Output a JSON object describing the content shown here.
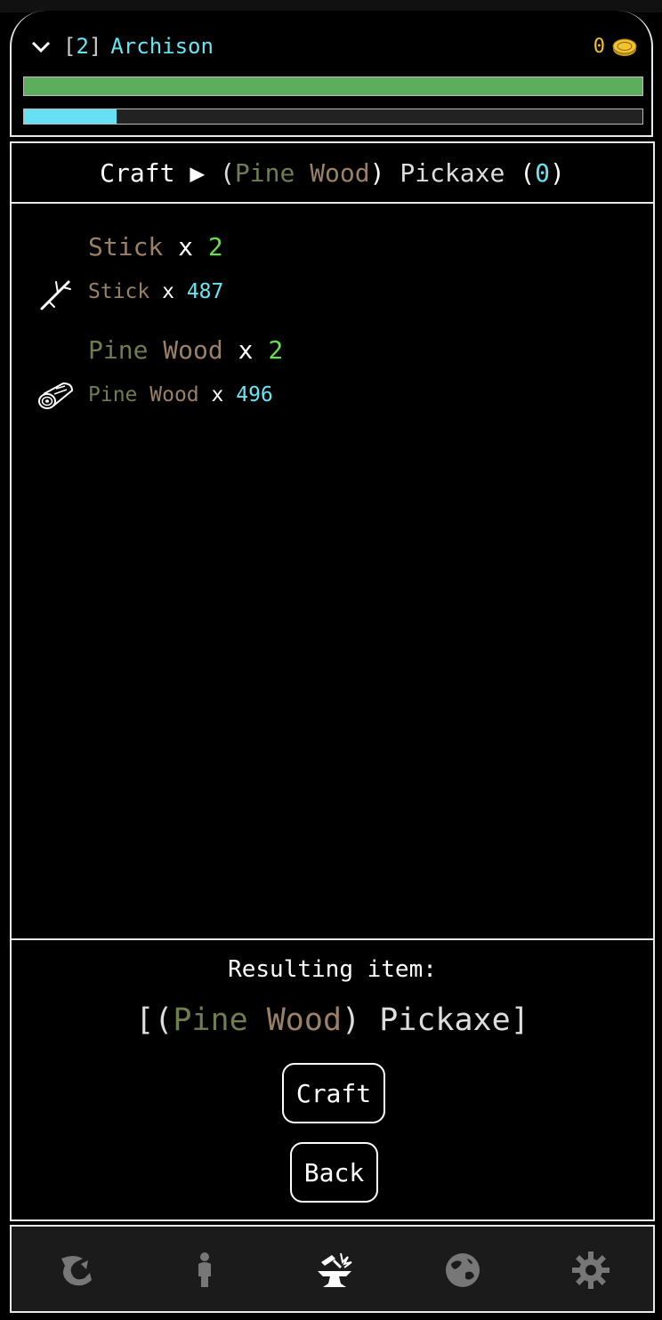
{
  "header": {
    "level_open": "[",
    "level": "2",
    "level_close": "]",
    "player_name": "Archison",
    "gold": "0",
    "health_fraction": 1.0,
    "xp_fraction": 0.15
  },
  "title": {
    "prefix": "Craft",
    "arrow": "▶",
    "open_paren": "(",
    "material_1": "Pine",
    "material_2": "Wood",
    "close_paren": ")",
    "item": "Pickaxe",
    "count_open": "(",
    "count": "0",
    "count_close": ")"
  },
  "ingredients": [
    {
      "icon": "stick-icon",
      "name": "Stick",
      "x": "x",
      "required": "2",
      "have_name": "Stick",
      "have": "487"
    },
    {
      "icon": "log-icon",
      "name_1": "Pine",
      "name_2": "Wood",
      "x": "x",
      "required": "2",
      "have_name_1": "Pine",
      "have_name_2": "Wood",
      "have": "496"
    }
  ],
  "result": {
    "label": "Resulting item:",
    "open": "[(",
    "material_1": "Pine",
    "material_2": "Wood",
    "mid": ")",
    "item": "Pickaxe",
    "close": "]"
  },
  "buttons": {
    "craft": "Craft",
    "back": "Back"
  },
  "nav": [
    "dragon-icon",
    "character-icon",
    "anvil-icon",
    "world-icon",
    "gear-icon"
  ],
  "colors": {
    "cyan": "#66e5f2",
    "green": "#63e04a",
    "pine": "#6f7d50",
    "wood": "#9b8068",
    "gold": "#f2c230",
    "health": "#5cad5c"
  }
}
